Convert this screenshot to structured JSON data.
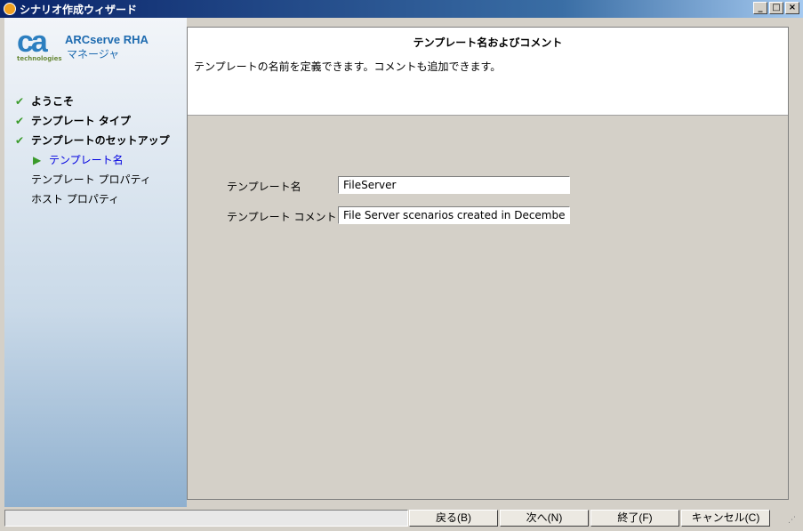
{
  "window": {
    "title": "シナリオ作成ウィザード",
    "minimize": "_",
    "maximize": "□",
    "close": "×"
  },
  "brand": {
    "logo": "ca",
    "logo_sub": "technologies",
    "product": "ARCserve RHA",
    "subtitle": "マネージャ"
  },
  "steps": [
    {
      "label": "ようこそ",
      "state": "done"
    },
    {
      "label": "テンプレート タイプ",
      "state": "done"
    },
    {
      "label": "テンプレートのセットアップ",
      "state": "done"
    },
    {
      "label": "テンプレート名",
      "state": "current"
    },
    {
      "label": "テンプレート プロパティ",
      "state": "pending"
    },
    {
      "label": "ホスト プロパティ",
      "state": "pending"
    }
  ],
  "header": {
    "title": "テンプレート名およびコメント",
    "description": "テンプレートの名前を定義できます。コメントも追加できます。"
  },
  "form": {
    "name_label": "テンプレート名",
    "name_value": "FileServer",
    "comment_label": "テンプレート コメント",
    "comment_value": "File Server scenarios created in December"
  },
  "buttons": {
    "back": "戻る(B)",
    "next": "次へ(N)",
    "finish": "終了(F)",
    "cancel": "キャンセル(C)"
  }
}
